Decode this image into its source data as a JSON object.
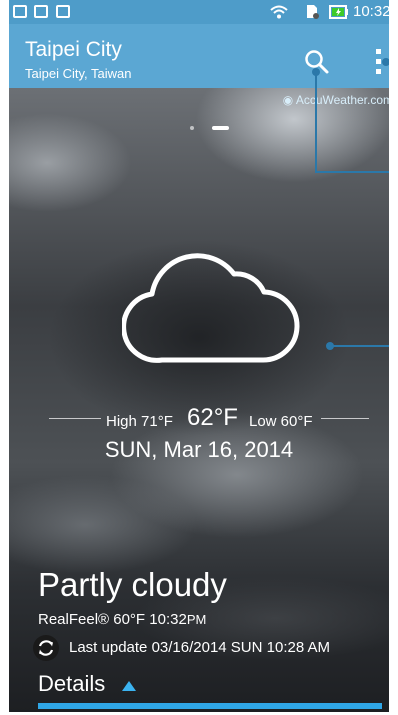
{
  "status_bar": {
    "time": "10:32"
  },
  "header": {
    "city": "Taipei City",
    "region": "Taipei City, Taiwan",
    "search_icon": "search-icon",
    "menu_icon": "more-vert-icon"
  },
  "provider": {
    "label": "AccuWeather.com"
  },
  "pager": {
    "pages": 2,
    "active": 2
  },
  "weather": {
    "icon": "cloud-icon",
    "high": "High 71°F",
    "current": "62°F",
    "low": "Low 60°F",
    "date": "SUN, Mar 16, 2014",
    "condition": "Partly cloudy",
    "realfeel": "RealFeel® 60°F  10:32",
    "realfeel_suffix": "PM",
    "last_update": "Last update 03/16/2014 SUN 10:28 AM",
    "refresh_icon": "refresh-icon"
  },
  "details": {
    "label": "Details"
  },
  "colors": {
    "status_bar": "#4e9cc9",
    "app_bar": "#5ba7d3",
    "accent": "#2fa6e6",
    "callout": "#2b78a9"
  }
}
